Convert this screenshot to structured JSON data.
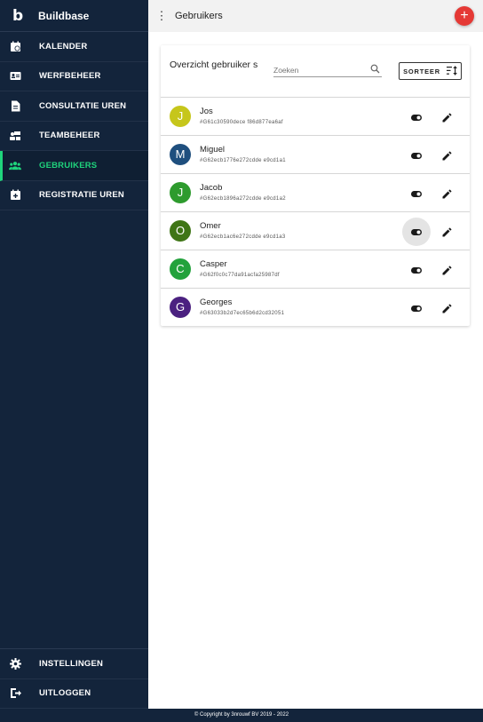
{
  "brand": {
    "logo": "b",
    "name": "Buildbase"
  },
  "nav": [
    {
      "label": "KALENDER",
      "icon": "calendar-clock-icon"
    },
    {
      "label": "WERFBEHEER",
      "icon": "id-card-icon"
    },
    {
      "label": "CONSULTATIE UREN",
      "icon": "document-icon"
    },
    {
      "label": "TEAMBEHEER",
      "icon": "team-icon"
    },
    {
      "label": "GEBRUIKERS",
      "icon": "users-icon",
      "active": true
    },
    {
      "label": "REGISTRATIE UREN",
      "icon": "calendar-add-icon"
    }
  ],
  "nav_bottom": [
    {
      "label": "INSTELLINGEN",
      "icon": "gear-icon"
    },
    {
      "label": "UITLOGGEN",
      "icon": "logout-icon"
    }
  ],
  "topbar": {
    "title": "Gebruikers",
    "add_label": "+"
  },
  "card": {
    "title": "Overzicht gebruiker s",
    "search_placeholder": "Zoeken",
    "sort_label": "SORTEER"
  },
  "users": [
    {
      "initial": "J",
      "name": "Jos",
      "id": "#G61c30590dece f86d877ea6af",
      "color": "#c6c61b"
    },
    {
      "initial": "M",
      "name": "Miguel",
      "id": "#G62ecb1776e272cdde e9cd1a1",
      "color": "#1f4f7e"
    },
    {
      "initial": "J",
      "name": "Jacob",
      "id": "#G62ecb1896a272cdde e9cd1a2",
      "color": "#2e9b2e"
    },
    {
      "initial": "O",
      "name": "Omer",
      "id": "#G62ecb1ac6e272cdde e9cd1a3",
      "color": "#3f7516"
    },
    {
      "initial": "C",
      "name": "Casper",
      "id": "#G62f0c0c77da91acfa25987df",
      "color": "#23a23c"
    },
    {
      "initial": "G",
      "name": "Georges",
      "id": "#G63033b2d7ec65b6d2cd32051",
      "color": "#4b2180"
    }
  ],
  "footer": "© Copyright by 3nrouwf BV 2019 - 2022",
  "colors": {
    "sidebar": "#13243b",
    "accent": "#1fd47c",
    "add": "#e53935"
  }
}
